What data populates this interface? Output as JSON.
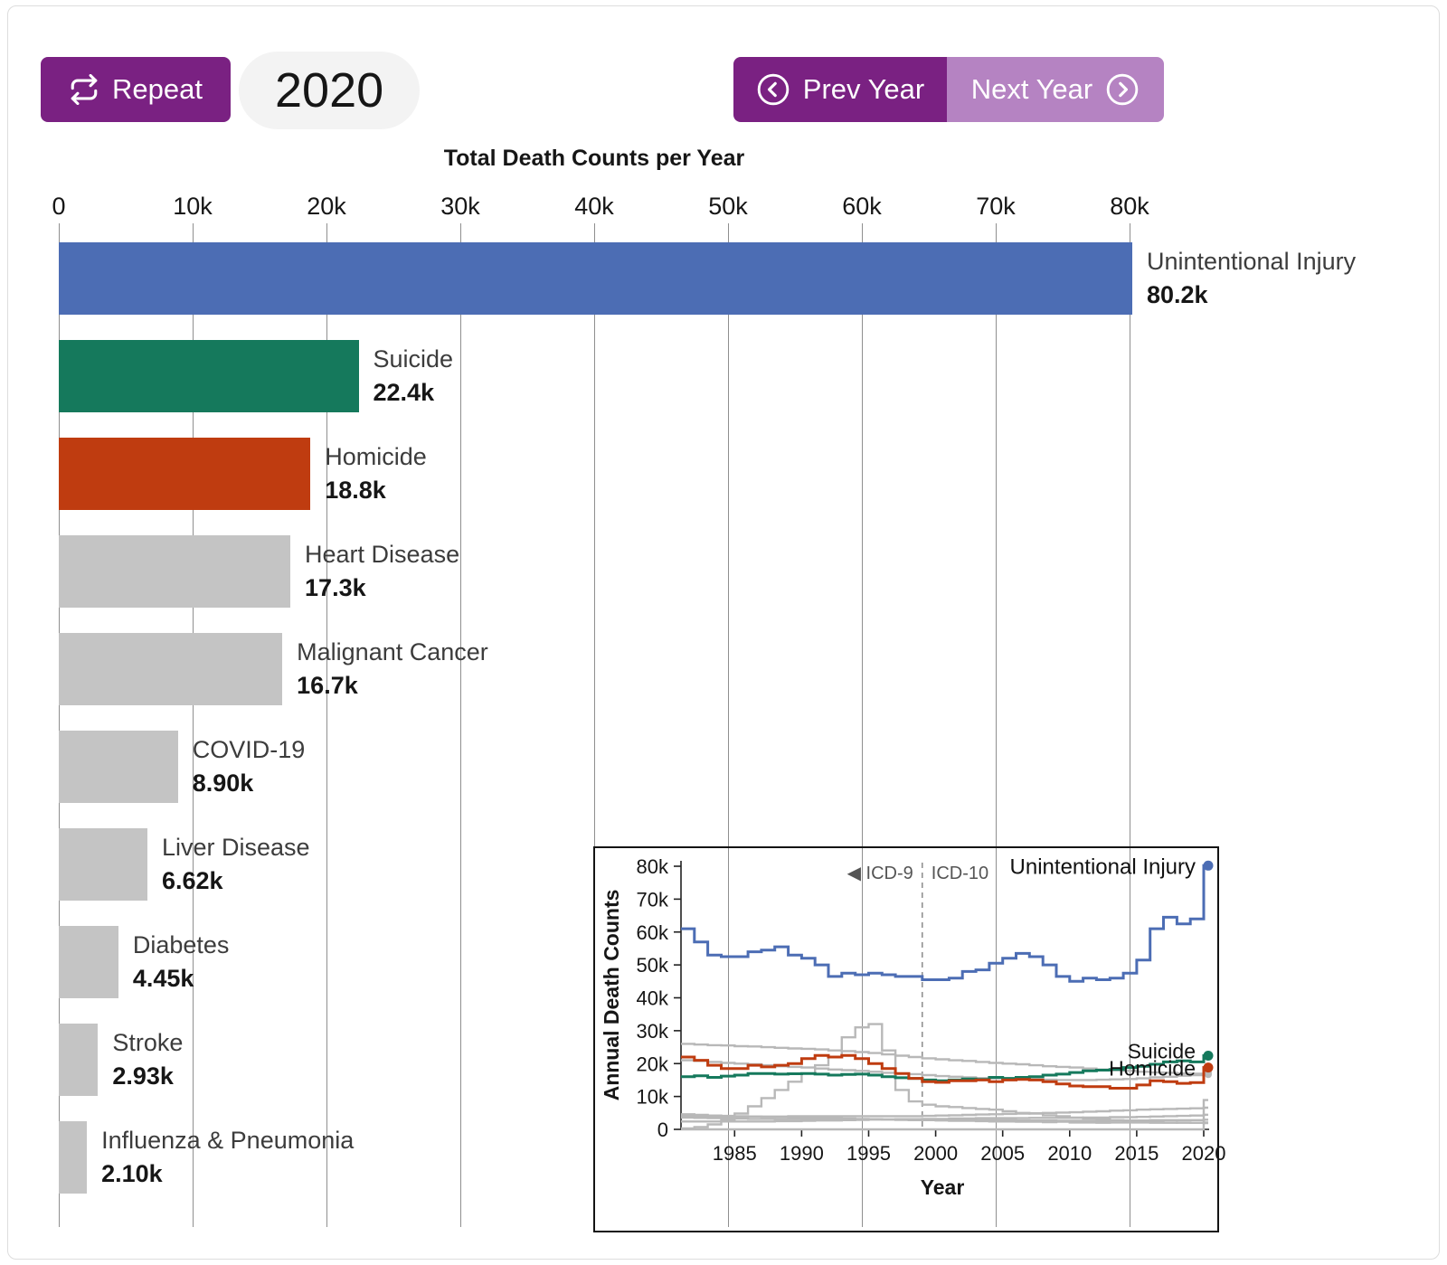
{
  "controls": {
    "repeat_label": "Repeat",
    "year_display": "2020",
    "prev_year_label": "Prev Year",
    "next_year_label": "Next Year",
    "icons": {
      "repeat": "repeat-loop-arrows",
      "prev": "circled-chevron-left",
      "next": "circled-chevron-right"
    },
    "colors": {
      "primary_purple": "#7a2182",
      "light_purple": "#b583c2",
      "year_pill_bg": "#f3f3f3"
    }
  },
  "chart_data": [
    {
      "type": "bar",
      "orientation": "horizontal",
      "title": "Total Death Counts per Year",
      "xlim": [
        0,
        80000
      ],
      "x_ticks": [
        "0",
        "10k",
        "20k",
        "30k",
        "40k",
        "50k",
        "60k",
        "70k",
        "80k"
      ],
      "grid": true,
      "bars": [
        {
          "label": "Unintentional Injury",
          "value": 80200,
          "display": "80.2k",
          "color": "#4c6db4"
        },
        {
          "label": "Suicide",
          "value": 22400,
          "display": "22.4k",
          "color": "#15795c"
        },
        {
          "label": "Homicide",
          "value": 18800,
          "display": "18.8k",
          "color": "#bf3c10"
        },
        {
          "label": "Heart Disease",
          "value": 17300,
          "display": "17.3k",
          "color": "#c4c4c4"
        },
        {
          "label": "Malignant Cancer",
          "value": 16700,
          "display": "16.7k",
          "color": "#c4c4c4"
        },
        {
          "label": "COVID-19",
          "value": 8900,
          "display": "8.90k",
          "color": "#c4c4c4"
        },
        {
          "label": "Liver Disease",
          "value": 6620,
          "display": "6.62k",
          "color": "#c4c4c4"
        },
        {
          "label": "Diabetes",
          "value": 4450,
          "display": "4.45k",
          "color": "#c4c4c4"
        },
        {
          "label": "Stroke",
          "value": 2930,
          "display": "2.93k",
          "color": "#c4c4c4"
        },
        {
          "label": "Influenza & Pneumonia",
          "value": 2100,
          "display": "2.10k",
          "color": "#c4c4c4"
        }
      ]
    },
    {
      "type": "line",
      "style": "step",
      "xlabel": "Year",
      "ylabel": "Annual Death Counts",
      "xlim": [
        1981,
        2020
      ],
      "ylim_k": [
        0,
        80
      ],
      "units": "values_k are thousands of deaths per year",
      "x_ticks": [
        "1985",
        "1990",
        "1995",
        "2000",
        "2005",
        "2010",
        "2015",
        "2020"
      ],
      "y_ticks": [
        "0",
        "10k",
        "20k",
        "30k",
        "40k",
        "50k",
        "60k",
        "70k",
        "80k"
      ],
      "divider": {
        "year": 1999,
        "left_label": "◀ ICD-9",
        "right_label": "ICD-10"
      },
      "legend_position": "end-of-line",
      "series": [
        {
          "id": "unintentional-injury",
          "name": "Unintentional Injury",
          "color": "#4c6db4",
          "gray": false,
          "dot": true,
          "end_label": true,
          "values_k": [
            61,
            57,
            53,
            52.5,
            52.5,
            54,
            54.5,
            55.5,
            53,
            52,
            50,
            46.5,
            47.5,
            47,
            47.5,
            47,
            46.5,
            46.5,
            45.5,
            45.5,
            46,
            48,
            48.5,
            50.5,
            52,
            53.5,
            52.5,
            50,
            46.5,
            45,
            46,
            45.5,
            46,
            47.5,
            51.5,
            61,
            64.5,
            62.5,
            64,
            80.2
          ]
        },
        {
          "id": "suicide",
          "name": "Suicide",
          "color": "#15795c",
          "gray": false,
          "dot": true,
          "end_label": true,
          "values_k": [
            16,
            16.3,
            15.8,
            16.2,
            16.5,
            17,
            17,
            16.8,
            16.9,
            17,
            16.8,
            16.5,
            16.7,
            16.8,
            16.5,
            16,
            15.7,
            15.5,
            15,
            14.8,
            15,
            15.3,
            15.2,
            15.8,
            15.5,
            15.8,
            16,
            16.5,
            16.8,
            17.3,
            17.8,
            18,
            18.2,
            18.8,
            19.2,
            19.8,
            20.5,
            20.8,
            20.5,
            22.4
          ]
        },
        {
          "id": "homicide",
          "name": "Homicide",
          "color": "#bf3c10",
          "gray": false,
          "dot": true,
          "end_label": true,
          "values_k": [
            22,
            21,
            19.5,
            18.5,
            18.5,
            19.5,
            19,
            19.5,
            20,
            21.5,
            22.5,
            22,
            22.5,
            21.5,
            20,
            18.5,
            17,
            15.5,
            14.5,
            14.3,
            14.8,
            14.8,
            15,
            14.5,
            15,
            15.2,
            15,
            14.5,
            13.8,
            13.2,
            13,
            13,
            12.5,
            12.5,
            13.5,
            14.8,
            14.5,
            14,
            14.2,
            18.8
          ]
        },
        {
          "id": "gray-1",
          "name": "",
          "color": "#b8b8b8",
          "gray": true,
          "dot": true,
          "end_label": false,
          "values_k": [
            26,
            25.8,
            25.6,
            25.5,
            25.3,
            25.2,
            25,
            24.8,
            24.6,
            24.5,
            24.3,
            24,
            23.8,
            23.5,
            23.2,
            22.8,
            22.4,
            22,
            21.6,
            21.3,
            21,
            20.8,
            20.5,
            20.2,
            20,
            19.8,
            19.5,
            19.2,
            19,
            18.8,
            18.5,
            18.2,
            18,
            17.8,
            17.5,
            17.3,
            17.2,
            17,
            16.9,
            16.7
          ]
        },
        {
          "id": "gray-2",
          "name": "",
          "color": "#b8b8b8",
          "gray": true,
          "dot": true,
          "end_label": false,
          "values_k": [
            21,
            20.8,
            20.5,
            20.2,
            20,
            19.8,
            19.5,
            19.2,
            19,
            18.8,
            18.5,
            18.2,
            18,
            17.8,
            17.5,
            17.2,
            17,
            16.8,
            16.5,
            16.2,
            16,
            15.8,
            15.6,
            15.5,
            15.4,
            15.3,
            15.2,
            15.1,
            15,
            15,
            15,
            15.1,
            15.2,
            15.3,
            15.5,
            15.8,
            16,
            16.3,
            16.5,
            17.3
          ]
        },
        {
          "id": "gray-3",
          "name": "",
          "color": "#b8b8b8",
          "gray": true,
          "dot": false,
          "end_label": false,
          "values_k": [
            0.3,
            0.7,
            1.5,
            2.8,
            4.8,
            7,
            9.5,
            12,
            14.5,
            17,
            19.5,
            22,
            28,
            31,
            32,
            24,
            12,
            8.5,
            7.5,
            7,
            6.8,
            6.5,
            6.2,
            6,
            5.5,
            5,
            4.8,
            4.3,
            4,
            3.6,
            3.3,
            3,
            2.8,
            2.5,
            2.3,
            2.2,
            2.1,
            2,
            2,
            1.9
          ]
        },
        {
          "id": "gray-4",
          "name": "",
          "color": "#b8b8b8",
          "gray": true,
          "dot": false,
          "end_label": false,
          "values_k": [
            4,
            4,
            4,
            3.9,
            3.9,
            3.9,
            3.9,
            3.9,
            4,
            4,
            4,
            4,
            4,
            4,
            4,
            4,
            4,
            4,
            4.1,
            4.2,
            4.3,
            4.4,
            4.5,
            4.6,
            4.7,
            4.8,
            4.9,
            5,
            5.1,
            5.2,
            5.4,
            5.5,
            5.7,
            5.8,
            6,
            6.1,
            6.2,
            6.3,
            6.4,
            6.6
          ]
        },
        {
          "id": "gray-5",
          "name": "",
          "color": "#b8b8b8",
          "gray": true,
          "dot": false,
          "end_label": false,
          "values_k": [
            2.4,
            2.4,
            2.4,
            2.4,
            2.4,
            2.4,
            2.4,
            2.5,
            2.5,
            2.6,
            2.7,
            2.7,
            2.8,
            2.9,
            3,
            3,
            3.1,
            3.1,
            3.2,
            3.2,
            3.3,
            3.3,
            3.4,
            3.4,
            3.4,
            3.4,
            3.5,
            3.5,
            3.5,
            3.5,
            3.6,
            3.6,
            3.7,
            3.7,
            3.8,
            3.9,
            4,
            4.1,
            4.2,
            4.45
          ]
        },
        {
          "id": "gray-6",
          "name": "",
          "color": "#b8b8b8",
          "gray": true,
          "dot": false,
          "end_label": false,
          "values_k": [
            3.6,
            3.5,
            3.4,
            3.3,
            3.3,
            3.2,
            3.2,
            3.1,
            3.1,
            3,
            3,
            3,
            3,
            3,
            3,
            3,
            3,
            2.9,
            2.9,
            2.9,
            2.9,
            2.9,
            2.8,
            2.8,
            2.8,
            2.7,
            2.7,
            2.7,
            2.6,
            2.6,
            2.6,
            2.6,
            2.7,
            2.7,
            2.7,
            2.8,
            2.8,
            2.8,
            2.8,
            2.93
          ]
        },
        {
          "id": "gray-7",
          "name": "",
          "color": "#b8b8b8",
          "gray": true,
          "dot": false,
          "end_label": false,
          "values_k": [
            4.6,
            4.4,
            4.2,
            4.1,
            4,
            3.9,
            3.8,
            3.8,
            3.7,
            3.6,
            3.5,
            3.4,
            3.3,
            3.2,
            3.1,
            3,
            2.9,
            2.8,
            2.8,
            2.7,
            2.6,
            2.6,
            2.5,
            2.4,
            2.4,
            2.3,
            2.3,
            2.2,
            2.3,
            2.1,
            2.1,
            2,
            2.1,
            2.1,
            2.1,
            2,
            2,
            2.1,
            2,
            2.1
          ]
        },
        {
          "id": "gray-8",
          "name": "",
          "color": "#b8b8b8",
          "gray": true,
          "dot": false,
          "end_label": false,
          "values_k": [
            0,
            0,
            0,
            0,
            0,
            0,
            0,
            0,
            0,
            0,
            0,
            0,
            0,
            0,
            0,
            0,
            0,
            0,
            0,
            0,
            0,
            0,
            0,
            0,
            0,
            0,
            0,
            0,
            0,
            0,
            0,
            0,
            0,
            0,
            0,
            0,
            0,
            0,
            0,
            8.9
          ]
        }
      ]
    }
  ]
}
